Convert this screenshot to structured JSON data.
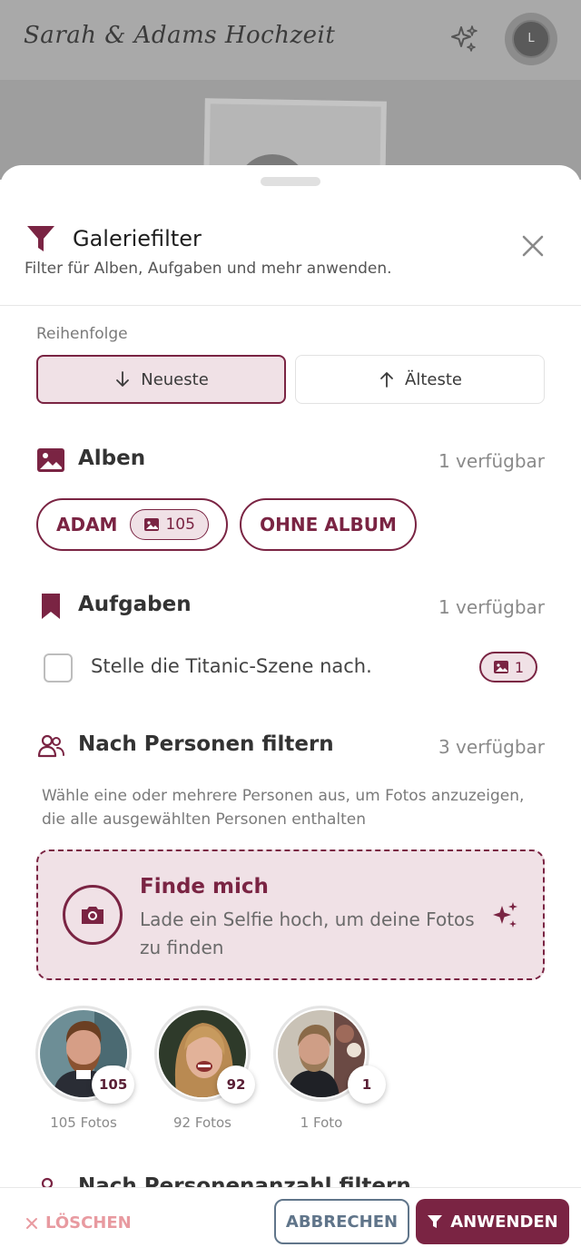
{
  "app": {
    "title": "Sarah & Adams Hochzeit",
    "avatar_initial": "L"
  },
  "sheet": {
    "title": "Galeriefilter",
    "subtitle": "Filter für Alben, Aufgaben und mehr anwenden.",
    "icon": "funnel-icon"
  },
  "order": {
    "label": "Reihenfolge",
    "newest": "Neueste",
    "oldest": "Älteste",
    "selected": "newest"
  },
  "albums": {
    "title": "Alben",
    "count": "1 verfügbar",
    "items": [
      {
        "label": "ADAM",
        "photo_count": "105"
      },
      {
        "label": "OHNE ALBUM"
      }
    ]
  },
  "tasks": {
    "title": "Aufgaben",
    "count": "1 verfügbar",
    "items": [
      {
        "label": "Stelle die Titanic-Szene nach.",
        "photo_count": "1",
        "checked": false
      }
    ]
  },
  "persons": {
    "title": "Nach Personen filtern",
    "count": "3 verfügbar",
    "description": "Wähle eine oder mehrere Personen aus, um Fotos anzuzeigen, die alle ausgewählten Personen enthalten",
    "find_me": {
      "title": "Finde mich",
      "subtitle": "Lade ein Selfie hoch, um deine Fotos zu finden"
    },
    "people": [
      {
        "count": "105",
        "label": "105 Fotos"
      },
      {
        "count": "92",
        "label": "92 Fotos"
      },
      {
        "count": "1",
        "label": "1 Foto"
      }
    ]
  },
  "next_section": {
    "title": "Nach Personenanzahl filtern"
  },
  "footer": {
    "clear": "LÖSCHEN",
    "cancel": "ABBRECHEN",
    "apply": "ANWENDEN"
  },
  "colors": {
    "accent": "#7a2443",
    "accent_light": "#f0e1e6",
    "clear": "#e89aa0",
    "cancel": "#60758a"
  }
}
